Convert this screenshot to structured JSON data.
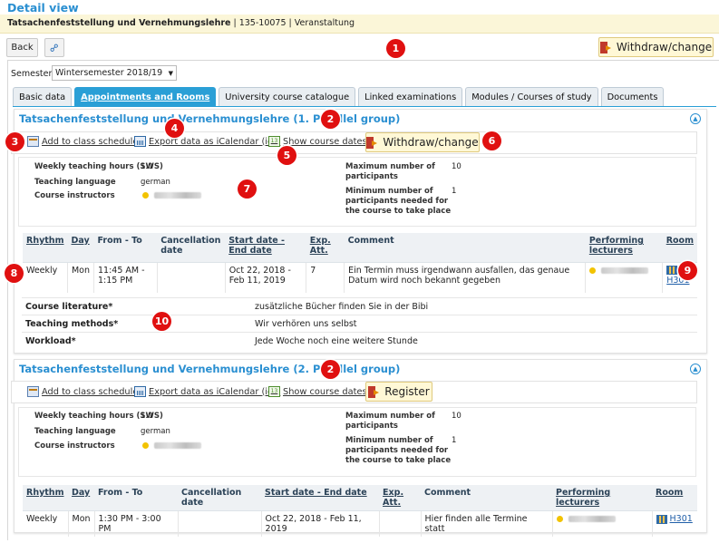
{
  "page": {
    "title": "Detail view",
    "breadcrumb_course": "Tatsachenfeststellung und Vernehmungslehre",
    "breadcrumb_rest": " | 135-10075 | Veranstaltung"
  },
  "toolbar": {
    "back_label": "Back",
    "withdraw_label": "Withdraw/change"
  },
  "semester": {
    "label": "Semester",
    "value": "Wintersemester 2018/19"
  },
  "tabs": [
    {
      "label": "Basic data",
      "active": false
    },
    {
      "label": "Appointments and Rooms",
      "active": true
    },
    {
      "label": "University course catalogue",
      "active": false
    },
    {
      "label": "Linked examinations",
      "active": false
    },
    {
      "label": "Modules / Courses of study",
      "active": false
    },
    {
      "label": "Documents",
      "active": false
    }
  ],
  "actions": {
    "add_schedule": "Add to class schedule",
    "export_ics": "Export data as iCalendar (ics)",
    "show_dates": "Show course dates"
  },
  "groups": [
    {
      "title": "Tatsachenfeststellung und Vernehmungslehre (1. Parallel group)",
      "button": "Withdraw/change",
      "info": {
        "sws_label": "Weekly teaching hours (SWS)",
        "sws_value": "1.0",
        "lang_label": "Teaching language",
        "lang_value": "german",
        "instructors_label": "Course instructors",
        "max_label": "Maximum number of participants",
        "max_value": "10",
        "min_label": "Minimum number of participants needed for the course to take place",
        "min_value": "1"
      },
      "headers": [
        "Rhythm",
        "Day",
        "From - To",
        "Cancellation date",
        "Start date - End date",
        "Exp. Att.",
        "Comment",
        "Performing lecturers",
        "Room"
      ],
      "row": {
        "rhythm": "Weekly",
        "day": "Mon",
        "time": "11:45 AM - 1:15 PM",
        "cancel": "",
        "dates": "Oct 22, 2018 - Feb 11, 2019",
        "exp": "7",
        "comment": "Ein Termin muss irgendwann ausfallen, das genaue Datum wird noch bekannt gegeben",
        "room": "H301"
      },
      "meta": [
        {
          "k": "Course literature*",
          "v": "zusätzliche Bücher finden Sie in der Bibi"
        },
        {
          "k": "Teaching methods*",
          "v": "Wir verhören uns selbst"
        },
        {
          "k": "Workload*",
          "v": "Jede Woche noch eine weitere Stunde"
        }
      ]
    },
    {
      "title": "Tatsachenfeststellung und Vernehmungslehre (2. Parallel group)",
      "button": "Register",
      "info": {
        "sws_label": "Weekly teaching hours (SWS)",
        "sws_value": "1.0",
        "lang_label": "Teaching language",
        "lang_value": "german",
        "instructors_label": "Course instructors",
        "max_label": "Maximum number of participants",
        "max_value": "10",
        "min_label": "Minimum number of participants needed for the course to take place",
        "min_value": "1"
      },
      "headers": [
        "Rhythm",
        "Day",
        "From - To",
        "Cancellation date",
        "Start date - End date",
        "Exp. Att.",
        "Comment",
        "Performing lecturers",
        "Room"
      ],
      "row": {
        "rhythm": "Weekly",
        "day": "Mon",
        "time": "1:30 PM - 3:00 PM",
        "cancel": "",
        "dates": "Oct 22, 2018 - Feb 11, 2019",
        "exp": "",
        "comment": "Hier finden alle Termine statt",
        "room": "H301"
      }
    }
  ],
  "badges": [
    "1",
    "2",
    "3",
    "4",
    "5",
    "6",
    "7",
    "8",
    "9",
    "10",
    "2"
  ],
  "colors": {
    "accent": "#2a9fd6",
    "badge": "#e01010",
    "highlight": "#fbf6d8"
  }
}
